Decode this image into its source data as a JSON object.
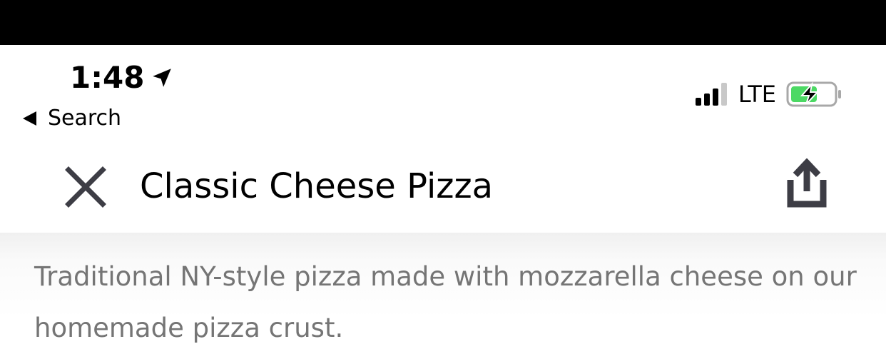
{
  "status_bar": {
    "time": "1:48",
    "location_icon": "location-arrow-icon",
    "back_label": "Search",
    "network": "LTE",
    "signal_bars_active": 3,
    "signal_bars_total": 4,
    "battery_charging": true,
    "battery_color": "#4cd964"
  },
  "header": {
    "close_icon": "close-icon",
    "title": "Classic Cheese Pizza",
    "share_icon": "share-icon"
  },
  "item": {
    "description": "Traditional NY-style pizza made with mozzarella cheese on our homemade pizza crust."
  },
  "colors": {
    "icon_color": "#3d3d45",
    "description_color": "#757575"
  }
}
